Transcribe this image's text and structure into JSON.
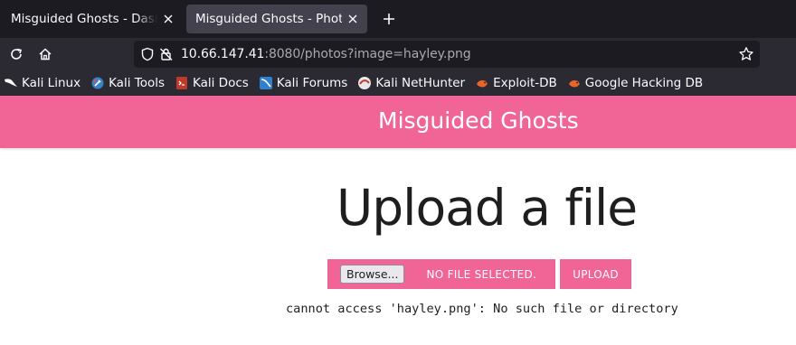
{
  "tabs": [
    {
      "label": "Misguided Ghosts - Dashboard",
      "active": false
    },
    {
      "label": "Misguided Ghosts - Photos",
      "active": true
    }
  ],
  "navbar": {
    "url_host": "10.66.147.41",
    "url_rest": ":8080/photos?image=hayley.png"
  },
  "bookmarks": [
    {
      "label": "Kali Linux",
      "icon": "kali-dragon-icon"
    },
    {
      "label": "Kali Tools",
      "icon": "kali-tools-icon"
    },
    {
      "label": "Kali Docs",
      "icon": "kali-docs-icon"
    },
    {
      "label": "Kali Forums",
      "icon": "kali-forums-icon"
    },
    {
      "label": "Kali NetHunter",
      "icon": "kali-nethunter-icon"
    },
    {
      "label": "Exploit-DB",
      "icon": "exploit-db-icon"
    },
    {
      "label": "Google Hacking DB",
      "icon": "ghdb-icon"
    }
  ],
  "page": {
    "site_title": "Misguided Ghosts",
    "heading": "Upload a file",
    "browse_label": "Browse...",
    "file_status": "NO FILE SELECTED.",
    "upload_label": "UPLOAD",
    "error": "cannot access 'hayley.png': No such file or directory"
  },
  "colors": {
    "accent": "#f06595",
    "chrome_dark": "#1c1b22",
    "chrome_mid": "#2b2a33"
  }
}
